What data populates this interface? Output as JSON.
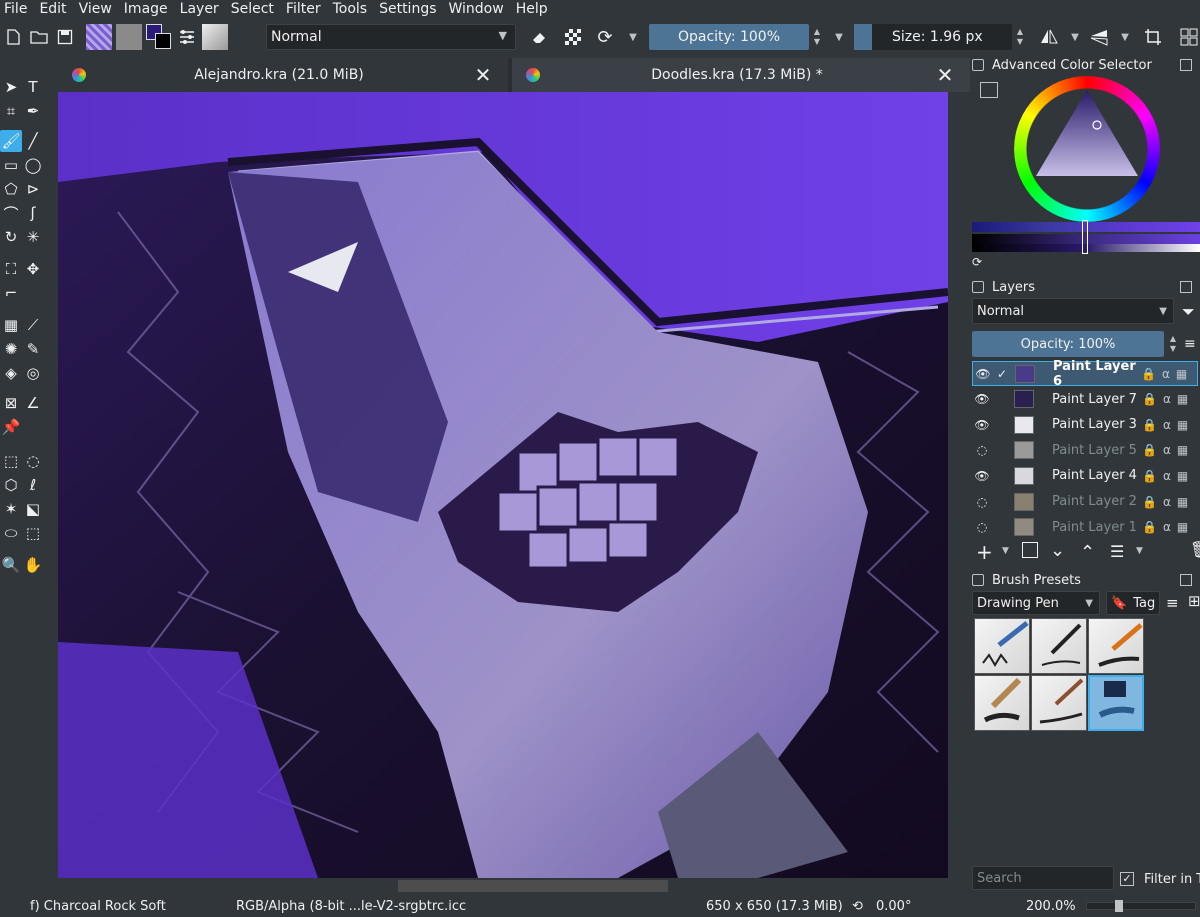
{
  "menu": [
    "File",
    "Edit",
    "View",
    "Image",
    "Layer",
    "Select",
    "Filter",
    "Tools",
    "Settings",
    "Window",
    "Help"
  ],
  "toolbar": {
    "blend_mode": "Normal",
    "opacity_label": "Opacity: 100%",
    "size_label": "Size: 1.96 px"
  },
  "tabs": [
    {
      "title": "Alejandro.kra (21.0 MiB)",
      "close": "✕",
      "active": false
    },
    {
      "title": "Doodles.kra (17.3 MiB) *",
      "close": "✕",
      "active": true
    }
  ],
  "color_selector": {
    "title": "Advanced Color Selector"
  },
  "layers": {
    "title": "Layers",
    "blend_mode": "Normal",
    "opacity_label": "Opacity:  100%",
    "items": [
      {
        "name": "Paint Layer 6",
        "visible": true,
        "selected": true,
        "thumb": "#4a3a8a"
      },
      {
        "name": "Paint Layer 7",
        "visible": true,
        "selected": false,
        "thumb": "#2a2050"
      },
      {
        "name": "Paint Layer 3",
        "visible": true,
        "selected": false,
        "thumb": "#e8e8f0"
      },
      {
        "name": "Paint Layer 5",
        "visible": false,
        "selected": false,
        "thumb": "#9a9a9a"
      },
      {
        "name": "Paint Layer 4",
        "visible": true,
        "selected": false,
        "thumb": "#d8d8e0"
      },
      {
        "name": "Paint Layer 2",
        "visible": false,
        "selected": false,
        "thumb": "#8a8070"
      },
      {
        "name": "Paint Layer 1",
        "visible": false,
        "selected": false,
        "thumb": "#908a80"
      }
    ]
  },
  "brush_presets": {
    "title": "Brush Presets",
    "current": "Drawing Pen",
    "tag_label": "Tag",
    "search_placeholder": "Search",
    "filter_label": "Filter in Ta"
  },
  "status": {
    "brush": "f) Charcoal Rock Soft",
    "color_space": "RGB/Alpha (8-bit ...le-V2-srgbtrc.icc",
    "dimensions": "650 x 650 (17.3 MiB)",
    "rotation": "0.00°",
    "zoom": "200.0%"
  },
  "colors": {
    "accent": "#3daee9",
    "panel": "#31363b",
    "art_purple": "#6a3ce0"
  }
}
